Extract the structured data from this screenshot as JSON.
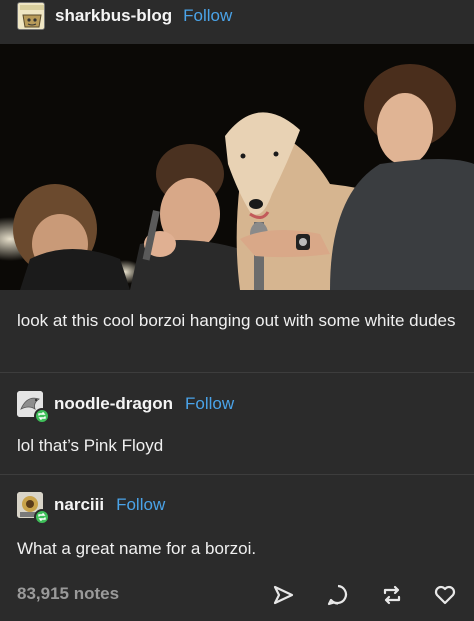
{
  "post": {
    "blog_name": "sharkbus-blog",
    "follow_label": "Follow",
    "avatar_text": "ENTIAL TOTEMITE",
    "photo_icon": "photo-of-borzoi-with-band",
    "text": "look at this cool borzoi hanging out with some white dudes"
  },
  "reblogs": [
    {
      "name": "noodle-dragon",
      "follow_label": "Follow",
      "text": "lol that’s Pink Floyd",
      "badge_icon": "reblog-icon"
    },
    {
      "name": "narciii",
      "follow_label": "Follow",
      "text": "What a great name for a borzoi.",
      "badge_icon": "reblog-icon"
    }
  ],
  "footer": {
    "notes": "83,915 notes",
    "actions": [
      "share-icon",
      "reply-icon",
      "reblog-icon",
      "like-icon"
    ]
  },
  "colors": {
    "background": "#2b2b2b",
    "link": "#4aa3e8",
    "badge": "#3fbf5a",
    "muted": "#9a9a9a"
  }
}
